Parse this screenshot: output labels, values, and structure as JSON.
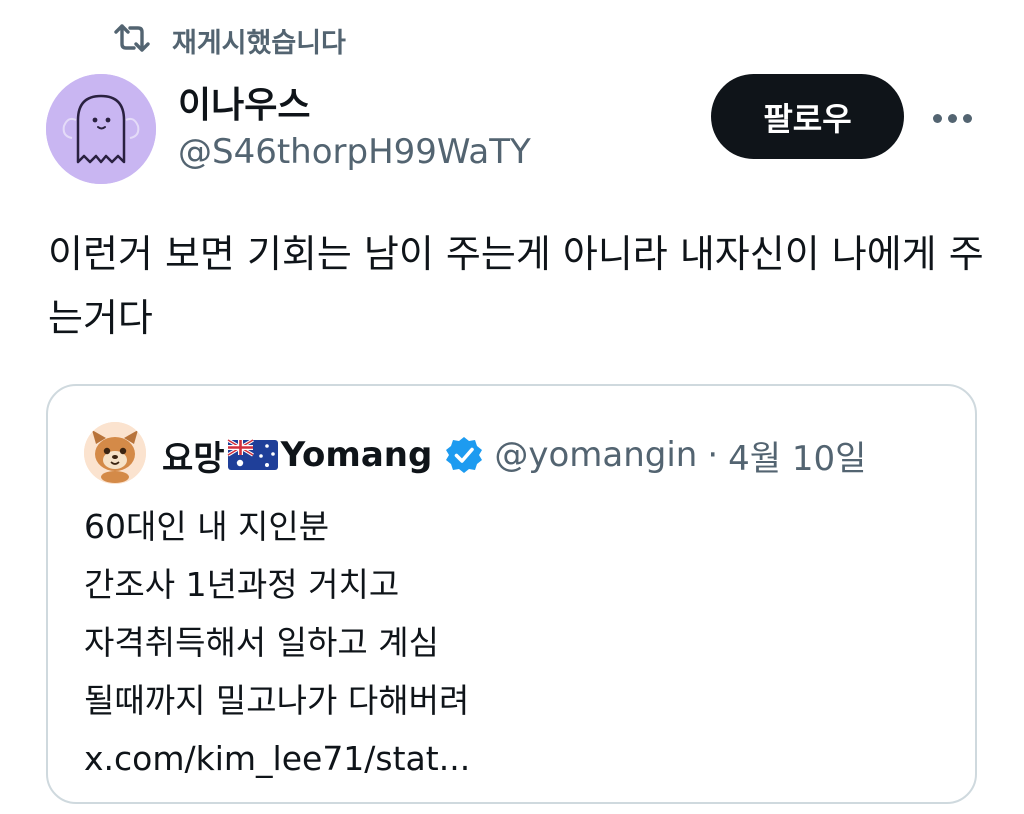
{
  "repost": {
    "icon": "repost-icon",
    "label": "재게시했습니다"
  },
  "author": {
    "display_name": "이나우스",
    "handle": "@S46thorpH99WaTY",
    "avatar": "ghost-avatar"
  },
  "actions": {
    "follow_label": "팔로우",
    "more_icon": "more-icon"
  },
  "tweet": {
    "text": "이런거 보면 기회는 남이 주는게 아니라 내자신이 나에게 주는거다"
  },
  "quote": {
    "name": "요망",
    "name_suffix": "Yomang",
    "flag": "australia-flag-icon",
    "verified_icon": "verified-badge-icon",
    "handle": "@yomangin",
    "separator": "·",
    "date": "4월 10일",
    "lines": [
      "60대인 내 지인분",
      "간조사 1년과정 거치고",
      "자격취득해서 일하고 계심",
      "될때까지 밀고나가 다해버려",
      "x.com/kim_lee71/stat..."
    ]
  },
  "colors": {
    "text": "#0f1419",
    "muted": "#536471",
    "border": "#cfd9de",
    "follow_bg": "#0f1419",
    "verified": "#1d9bf0",
    "avatar_bg": "#c9b6f2"
  }
}
